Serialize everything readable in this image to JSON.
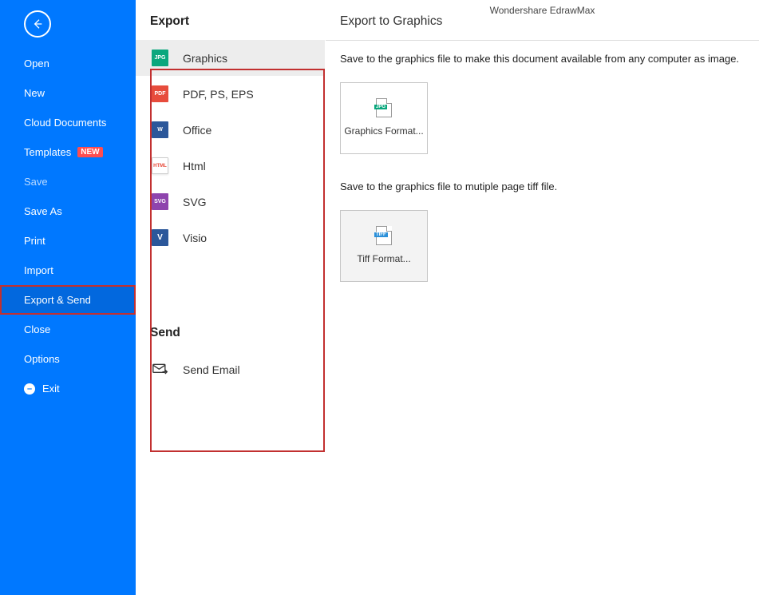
{
  "app": {
    "title": "Wondershare EdrawMax"
  },
  "sidebar": {
    "items": [
      {
        "label": "Open"
      },
      {
        "label": "New"
      },
      {
        "label": "Cloud Documents"
      },
      {
        "label": "Templates",
        "badge": "NEW"
      },
      {
        "label": "Save"
      },
      {
        "label": "Save As"
      },
      {
        "label": "Print"
      },
      {
        "label": "Import"
      },
      {
        "label": "Export & Send"
      },
      {
        "label": "Close"
      },
      {
        "label": "Options"
      },
      {
        "label": "Exit"
      }
    ]
  },
  "export": {
    "title": "Export",
    "options": [
      {
        "label": "Graphics",
        "tag": "JPG"
      },
      {
        "label": "PDF, PS, EPS",
        "tag": "PDF"
      },
      {
        "label": "Office",
        "tag": "W"
      },
      {
        "label": "Html",
        "tag": "HTML"
      },
      {
        "label": "SVG",
        "tag": "SVG"
      },
      {
        "label": "Visio",
        "tag": "V"
      }
    ]
  },
  "send": {
    "title": "Send",
    "items": [
      {
        "label": "Send Email"
      }
    ]
  },
  "right": {
    "title": "Export to Graphics",
    "desc1": "Save to the graphics file to make this document available from any computer as image.",
    "card1": {
      "tag": "JPG",
      "label": "Graphics Format..."
    },
    "desc2": "Save to the graphics file to mutiple page tiff file.",
    "card2": {
      "tag": "TIFF",
      "label": "Tiff Format..."
    }
  }
}
